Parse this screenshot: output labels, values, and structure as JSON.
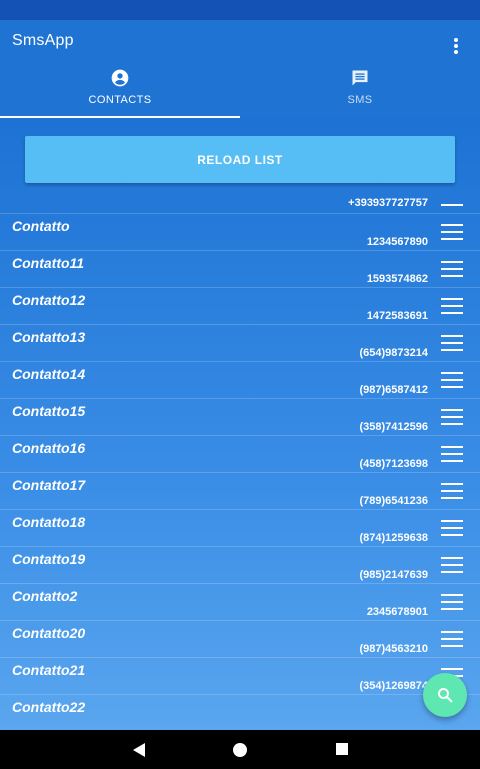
{
  "app": {
    "title": "SmsApp"
  },
  "tabs": [
    {
      "label": "CONTACTS",
      "icon": "account-circle-icon",
      "selected": true
    },
    {
      "label": "SMS",
      "icon": "message-icon",
      "selected": false
    }
  ],
  "reload_button": {
    "label": "RELOAD LIST"
  },
  "contacts": [
    {
      "name": "",
      "number": "+393937727757"
    },
    {
      "name": "Contatto",
      "number": "1234567890"
    },
    {
      "name": "Contatto11",
      "number": "1593574862"
    },
    {
      "name": "Contatto12",
      "number": "1472583691"
    },
    {
      "name": "Contatto13",
      "number": "(654)9873214"
    },
    {
      "name": "Contatto14",
      "number": "(987)6587412"
    },
    {
      "name": "Contatto15",
      "number": "(358)7412596"
    },
    {
      "name": "Contatto16",
      "number": "(458)7123698"
    },
    {
      "name": "Contatto17",
      "number": "(789)6541236"
    },
    {
      "name": "Contatto18",
      "number": "(874)1259638"
    },
    {
      "name": "Contatto19",
      "number": "(985)2147639"
    },
    {
      "name": "Contatto2",
      "number": "2345678901"
    },
    {
      "name": "Contatto20",
      "number": "(987)4563210"
    },
    {
      "name": "Contatto21",
      "number": "(354)1269874"
    },
    {
      "name": "Contatto22",
      "number": ""
    }
  ],
  "fab": {
    "icon": "search-icon"
  },
  "colors": {
    "status_bar": "#1453b5",
    "app_bar": "#1f73d2",
    "reload_button": "#56bdf5",
    "fab": "#5ee7b1"
  }
}
